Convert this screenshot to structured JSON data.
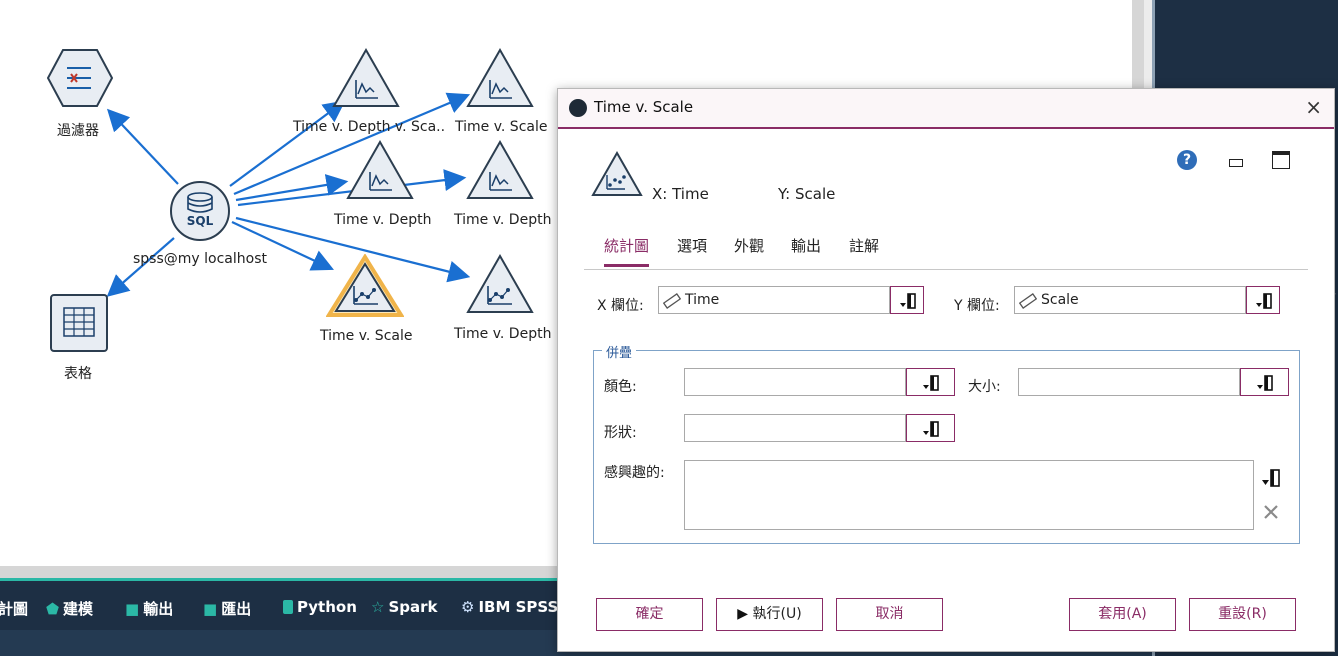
{
  "canvas": {
    "nodes": {
      "filter": "過濾器",
      "table": "表格",
      "sql_source": "spss@my localhost",
      "sql_badge": "SQL",
      "graph1": "Time v. Depth v. Sca..",
      "graph2": "Time v. Scale",
      "graph3": "Time v. Depth",
      "graph4": "Time v. Depth",
      "graph5": "Time v. Scale",
      "graph6": "Time v. Depth"
    }
  },
  "palette": {
    "tabs": [
      {
        "label": "計圖",
        "icon": ""
      },
      {
        "label": "建模",
        "icon": "pentagon-icon"
      },
      {
        "label": "輸出",
        "icon": "square-icon"
      },
      {
        "label": "匯出",
        "icon": "square-icon"
      },
      {
        "label": "Python",
        "icon": "python-icon"
      },
      {
        "label": "Spark",
        "icon": "star-icon"
      },
      {
        "label": "IBM SPSS",
        "icon": "spss-icon"
      }
    ]
  },
  "dialog": {
    "title": "Time v. Scale",
    "close": "×",
    "x_summary": "X: Time",
    "y_summary": "Y: Scale",
    "help": "?",
    "tabs": [
      "統計圖",
      "選項",
      "外觀",
      "輸出",
      "註解"
    ],
    "active_tab": 0,
    "x_field_label": "X 欄位:",
    "x_field_value": "Time",
    "y_field_label": "Y 欄位:",
    "y_field_value": "Scale",
    "overlay_legend": "併疊",
    "color_label": "顏色:",
    "color_value": "",
    "size_label": "大小:",
    "size_value": "",
    "shape_label": "形狀:",
    "shape_value": "",
    "interest_label": "感興趣的:",
    "buttons": {
      "ok": "確定",
      "run": "執行(U)",
      "cancel": "取消",
      "apply": "套用(A)",
      "reset": "重設(R)"
    }
  },
  "colors": {
    "accent": "#8a2c66",
    "link": "#1a6fd1",
    "dark_panel": "#1d2f44",
    "teal": "#2bb8a6",
    "selected_node": "#f0b44a"
  }
}
